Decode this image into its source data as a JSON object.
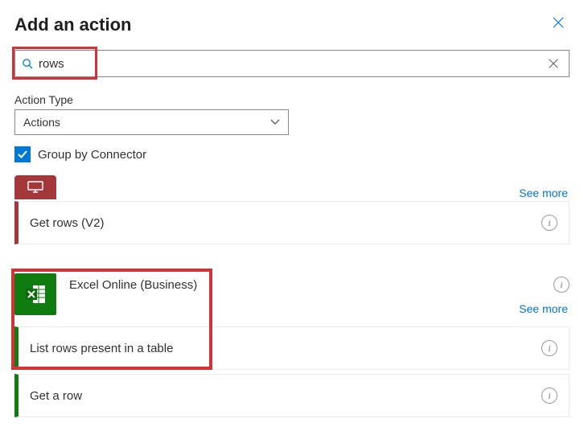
{
  "header": {
    "title": "Add an action"
  },
  "search": {
    "value": "rows"
  },
  "actionType": {
    "label": "Action Type",
    "selected": "Actions"
  },
  "groupBy": {
    "label": "Group by Connector",
    "checked": true
  },
  "seeMore": "See more",
  "group1": {
    "actions": [
      {
        "label": "Get rows (V2)"
      }
    ]
  },
  "group2": {
    "connector": "Excel Online (Business)",
    "actions": [
      {
        "label": "List rows present in a table"
      },
      {
        "label": "Get a row"
      }
    ]
  }
}
